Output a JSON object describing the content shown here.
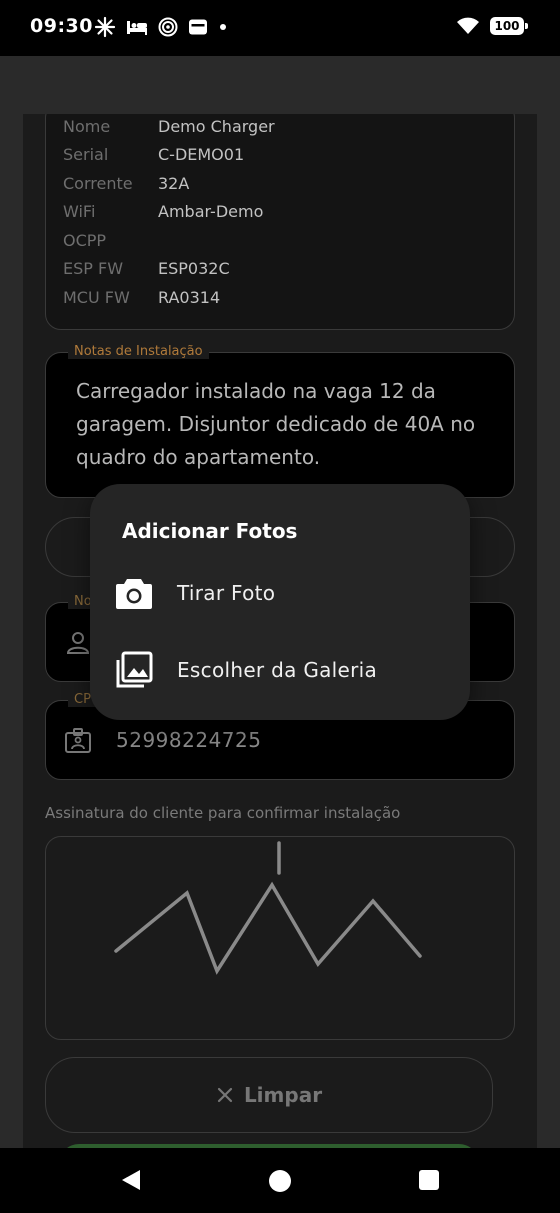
{
  "status_bar": {
    "time": "09:30",
    "battery": "100",
    "icons_left": [
      "sparkle-icon",
      "bed-icon",
      "radar-icon",
      "card-icon",
      "dot-icon"
    ],
    "icons_right": [
      "wifi-icon",
      "battery-icon"
    ]
  },
  "device_info": {
    "rows": [
      {
        "label": "Nome",
        "value": "Demo Charger"
      },
      {
        "label": "Serial",
        "value": "C-DEMO01"
      },
      {
        "label": "Corrente",
        "value": "32A"
      },
      {
        "label": "WiFi",
        "value": "Ambar-Demo"
      },
      {
        "label": "OCPP",
        "value": ""
      },
      {
        "label": "ESP FW",
        "value": "ESP032C"
      },
      {
        "label": "MCU FW",
        "value": "RA0314"
      }
    ]
  },
  "notes": {
    "label": "Notas de Instalação",
    "value": "Carregador instalado na vaga 12 da garagem. Disjuntor dedicado de 40A no quadro do apartamento."
  },
  "name_field": {
    "label": "No",
    "icon": "person-icon",
    "value": ""
  },
  "cpf_field": {
    "label": "CP",
    "icon": "id-card-icon",
    "value": "52998224725"
  },
  "signature": {
    "label": "Assinatura do cliente para confirmar instalação"
  },
  "clear_button": {
    "label": "Limpar"
  },
  "popup": {
    "title": "Adicionar Fotos",
    "items": [
      {
        "label": "Tirar Foto",
        "icon": "camera-icon"
      },
      {
        "label": "Escolher da Galeria",
        "icon": "gallery-icon"
      }
    ]
  },
  "nav": {
    "icons": [
      "back-icon",
      "home-icon",
      "recents-icon"
    ]
  },
  "colors": {
    "accent": "#b07a3a",
    "sheet_bg": "#1b1b1b",
    "popup_bg": "#252525"
  }
}
